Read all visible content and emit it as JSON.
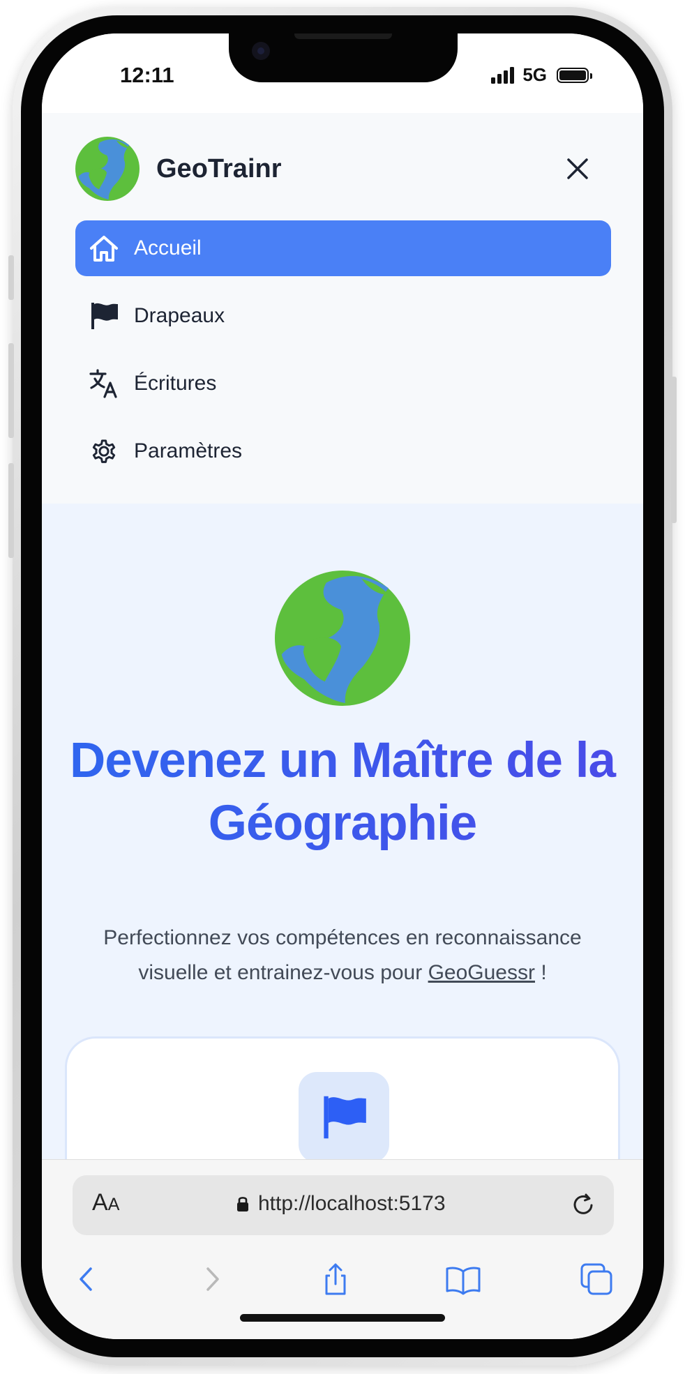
{
  "status_bar": {
    "time": "12:11",
    "network": "5G"
  },
  "nav": {
    "brand_name": "GeoTrainr",
    "items": [
      {
        "label": "Accueil",
        "icon": "home-icon",
        "active": true
      },
      {
        "label": "Drapeaux",
        "icon": "flag-icon",
        "active": false
      },
      {
        "label": "Écritures",
        "icon": "translate-icon",
        "active": false
      },
      {
        "label": "Paramètres",
        "icon": "gear-icon",
        "active": false
      }
    ]
  },
  "hero": {
    "title": "Devenez un Maître de la Géographie",
    "subtitle_before": "Perfectionnez vos compétences en reconnaissance visuelle et entrainez-vous pour",
    "subtitle_link": "GeoGuessr",
    "subtitle_after": " !"
  },
  "browser": {
    "text_size_big": "A",
    "text_size_small": "A",
    "url": "http://localhost:5173"
  },
  "colors": {
    "accent": "#4a80f6",
    "title": "#3b5bef",
    "globe_land": "#5dbf3d",
    "globe_ocean": "#4a90d9"
  }
}
